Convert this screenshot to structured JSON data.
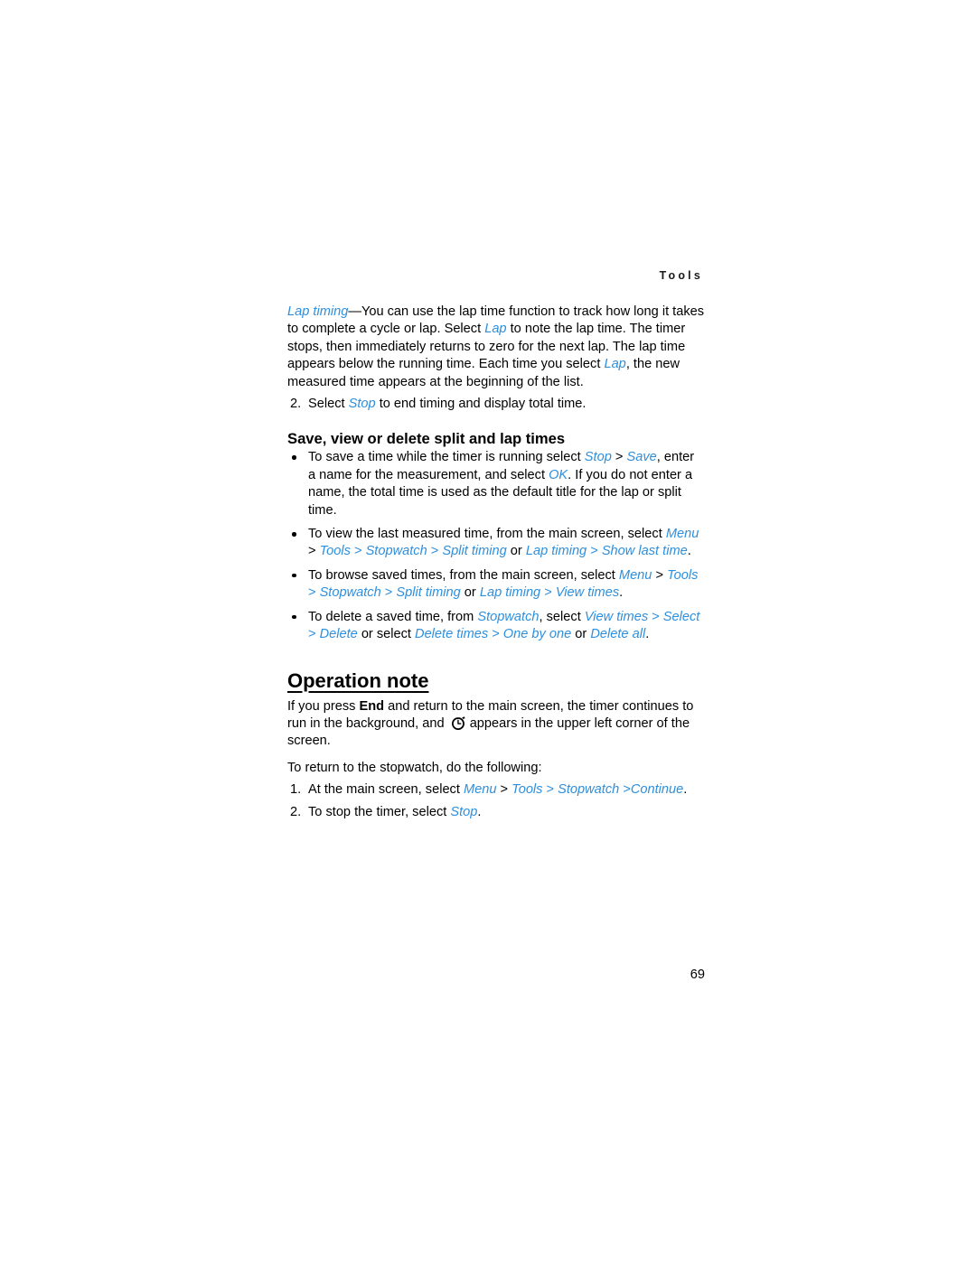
{
  "document": {
    "running_head": "Tools",
    "page_number": "69",
    "accent_color": "#2e8fdd",
    "text_color": "#000000",
    "background_color": "#ffffff"
  },
  "lap_timing_paragraph": {
    "term": "Lap timing",
    "dash": "—",
    "text_1": "You can use the lap time function to track how long it takes to complete a cycle or lap. Select ",
    "ui_1": "Lap",
    "text_2": " to note the lap time. The timer stops, then immediately returns to zero for the next lap. The lap time appears below the running time. Each time you select ",
    "ui_2": "Lap",
    "text_3": ", the new measured time appears at the beginning of the list."
  },
  "step_two": {
    "number": "2.",
    "text_1": "Select ",
    "ui_1": "Stop",
    "text_2": " to end timing and display total time."
  },
  "save_section": {
    "heading": "Save, view or delete split and lap times",
    "bullets": [
      {
        "text_1": "To save a time while the timer is running select ",
        "ui_1": "Stop",
        "sep_1": " > ",
        "ui_2": "Save",
        "text_2": ", enter a name for the measurement, and select ",
        "ui_3": "OK",
        "text_3": ". If you do not enter a name, the total time is used as the default title for the lap or split time."
      },
      {
        "text_1": "To view the last measured time, from the main screen, select ",
        "ui_1": "Menu",
        "sep_1": " > ",
        "ui_2": "Tools",
        "sep_2": " > ",
        "ui_3": "Stopwatch",
        "sep_3": " > ",
        "ui_4": "Split timing",
        "text_2": " or ",
        "ui_5": "Lap timing",
        "sep_4": " > ",
        "ui_6": "Show last time",
        "text_3": "."
      },
      {
        "text_1": "To browse saved times, from the main screen, select ",
        "ui_1": "Menu",
        "sep_1": " > ",
        "ui_2": "Tools",
        "sep_2": " > ",
        "ui_3": "Stopwatch",
        "sep_3": " > ",
        "ui_4": "Split timing",
        "text_2": " or ",
        "ui_5": "Lap timing",
        "sep_4": " > ",
        "ui_6": "View times",
        "text_3": "."
      },
      {
        "text_1": "To delete a saved time, from ",
        "ui_1": "Stopwatch",
        "text_2": ", select ",
        "ui_2": "View times",
        "sep_1": " > ",
        "ui_3": "Select",
        "sep_2": " > ",
        "ui_4": "Delete",
        "text_3": " or select ",
        "ui_5": "Delete times",
        "sep_3": " > ",
        "ui_6": "One by one",
        "text_4": " or ",
        "ui_7": "Delete all",
        "text_5": "."
      }
    ]
  },
  "operation_note": {
    "heading": "Operation note",
    "paragraph": {
      "text_1": "If you press ",
      "bold_1": "End",
      "text_2": " and return to the main screen, the timer continues to run in the background, and ",
      "icon": "stopwatch-icon",
      "text_3": "appears in the upper left corner of the screen."
    },
    "intro": "To return to the stopwatch, do the following:",
    "steps": [
      {
        "number": "1.",
        "text_1": "At the main screen, select ",
        "ui_1": "Menu",
        "sep_1": " > ",
        "ui_2": "Tools",
        "sep_2": " > ",
        "ui_3": "Stopwatch",
        "sep_3": " >",
        "ui_4": "Continue",
        "text_2": "."
      },
      {
        "number": "2.",
        "text_1": "To stop the timer, select ",
        "ui_1": "Stop",
        "text_2": "."
      }
    ]
  }
}
